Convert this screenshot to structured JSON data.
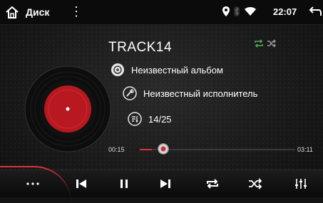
{
  "status_bar": {
    "title": "Диск",
    "time": "22:07",
    "icons": [
      "home-icon",
      "more-vertical-icon",
      "location-pin-icon",
      "bluetooth-icon",
      "wifi-icon",
      "back-icon"
    ]
  },
  "track": {
    "title": "TRACK14",
    "album": "Неизвестный альбом",
    "artist": "Неизвестный исполнитель",
    "position": "14/25"
  },
  "progress": {
    "current": "00:15",
    "total": "03:11",
    "fraction": 0.08
  },
  "controls": {
    "buttons": [
      "more-icon",
      "previous-icon",
      "pause-icon",
      "next-icon",
      "repeat-icon",
      "shuffle-icon",
      "equalizer-icon"
    ]
  },
  "colors": {
    "accent": "#e0323a",
    "active_mode": "#4caf50",
    "background": "#141414"
  }
}
